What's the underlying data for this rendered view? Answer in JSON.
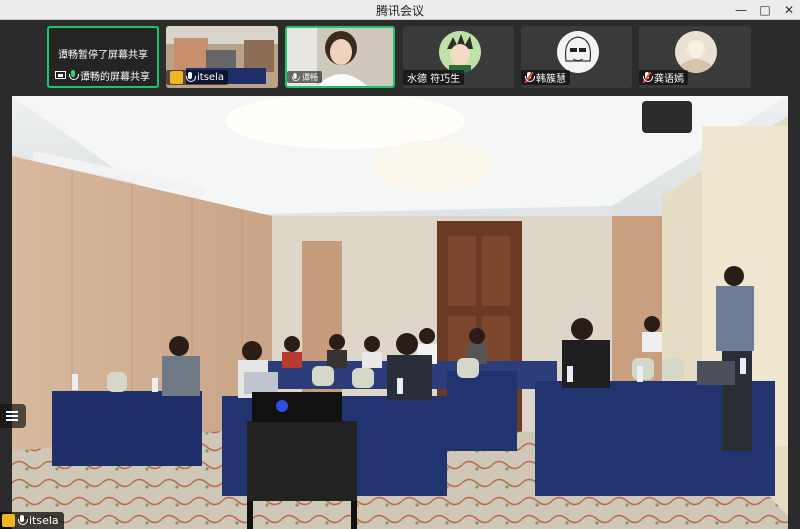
{
  "window": {
    "title": "腾讯会议",
    "minimize": "—",
    "maximize": "□",
    "close": "✕"
  },
  "participants": [
    {
      "name": "谭畅的屏幕共享",
      "status": "谭畅暂停了屏幕共享",
      "kind": "share"
    },
    {
      "name": "itsela",
      "kind": "video"
    },
    {
      "name": "谭畅",
      "kind": "video"
    },
    {
      "name": "水德 符巧生",
      "kind": "avatar"
    },
    {
      "name": "韩簇慧",
      "kind": "avatar"
    },
    {
      "name": "龚语嫣",
      "kind": "avatar"
    }
  ],
  "main_view": {
    "speaker": "itsela",
    "scene": "conference-room"
  },
  "colors": {
    "active_border": "#1ec46a",
    "accent_yellow": "#f0b61f"
  }
}
